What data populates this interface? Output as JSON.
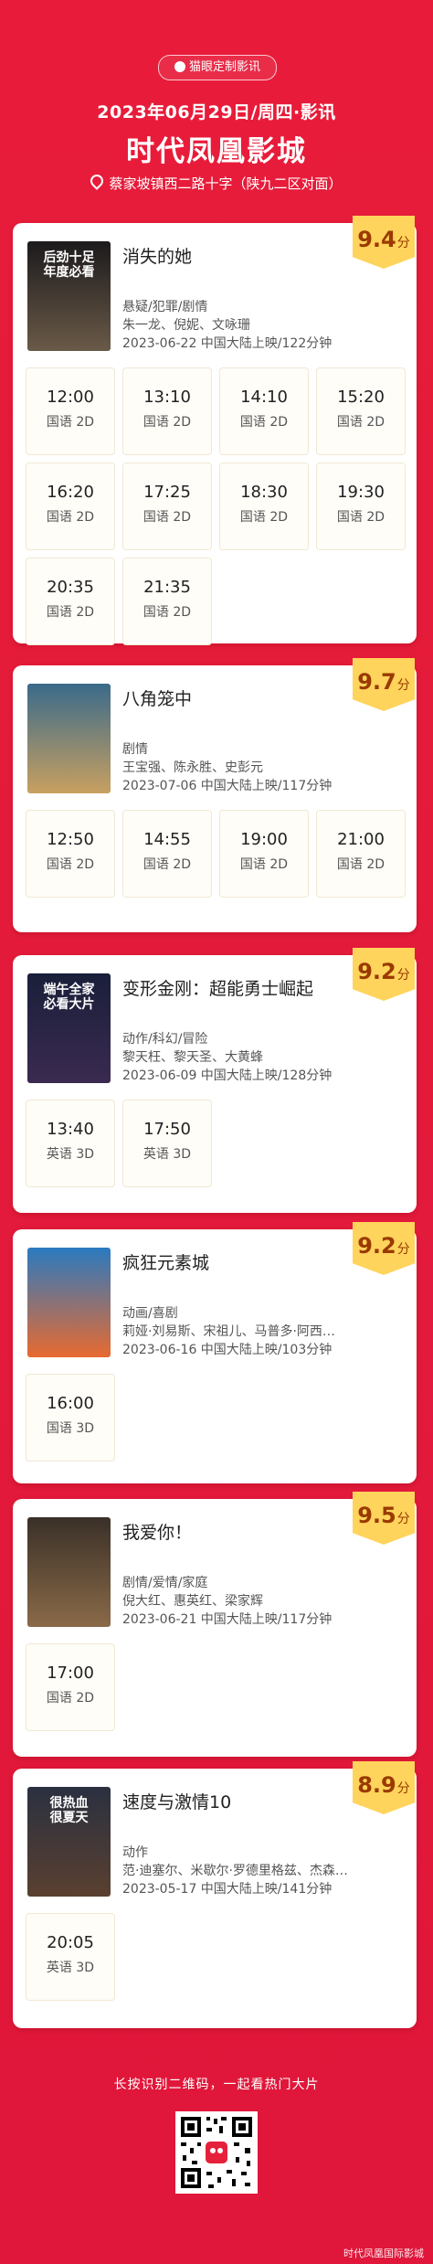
{
  "header": {
    "badge": "猫眼定制影讯",
    "date_line": "2023年06月29日/周四·影讯",
    "cinema_name": "时代凤凰影城",
    "address": "蔡家坡镇西二路十字（陕九二区对面）"
  },
  "movies": [
    {
      "title": "消失的她",
      "score": "9.4",
      "score_unit": "分",
      "genre": "悬疑/犯罪/剧情",
      "cast": "朱一龙、倪妮、文咏珊",
      "release": "2023-06-22 中国大陆上映/122分钟",
      "poster_text": "后劲十足\n年度必看",
      "poster_colors": [
        "#1c1a1c",
        "#6a5a48"
      ],
      "showtimes": [
        {
          "time": "12:00",
          "lang": "国语 2D"
        },
        {
          "time": "13:10",
          "lang": "国语 2D"
        },
        {
          "time": "14:10",
          "lang": "国语 2D"
        },
        {
          "time": "15:20",
          "lang": "国语 2D"
        },
        {
          "time": "16:20",
          "lang": "国语 2D"
        },
        {
          "time": "17:25",
          "lang": "国语 2D"
        },
        {
          "time": "18:30",
          "lang": "国语 2D"
        },
        {
          "time": "19:30",
          "lang": "国语 2D"
        },
        {
          "time": "20:35",
          "lang": "国语 2D"
        },
        {
          "time": "21:35",
          "lang": "国语 2D"
        }
      ]
    },
    {
      "title": "八角笼中",
      "score": "9.7",
      "score_unit": "分",
      "genre": "剧情",
      "cast": "王宝强、陈永胜、史彭元",
      "release": "2023-07-06 中国大陆上映/117分钟",
      "poster_text": "",
      "poster_colors": [
        "#3a6a8a",
        "#c8a060"
      ],
      "showtimes": [
        {
          "time": "12:50",
          "lang": "国语 2D"
        },
        {
          "time": "14:55",
          "lang": "国语 2D"
        },
        {
          "time": "19:00",
          "lang": "国语 2D"
        },
        {
          "time": "21:00",
          "lang": "国语 2D"
        }
      ]
    },
    {
      "title": "变形金刚：超能勇士崛起",
      "score": "9.2",
      "score_unit": "分",
      "genre": "动作/科幻/冒险",
      "cast": "黎天枉、黎天圣、大黄蜂",
      "release": "2023-06-09 中国大陆上映/128分钟",
      "poster_text": "端午全家\n必看大片",
      "poster_colors": [
        "#1a1f3a",
        "#3a2a50"
      ],
      "showtimes": [
        {
          "time": "13:40",
          "lang": "英语 3D"
        },
        {
          "time": "17:50",
          "lang": "英语 3D"
        }
      ]
    },
    {
      "title": "疯狂元素城",
      "score": "9.2",
      "score_unit": "分",
      "genre": "动画/喜剧",
      "cast": "莉娅·刘易斯、宋祖儿、马普多·阿西…",
      "release": "2023-06-16 中国大陆上映/103分钟",
      "poster_text": "",
      "poster_colors": [
        "#2a7ac0",
        "#e86a30"
      ],
      "showtimes": [
        {
          "time": "16:00",
          "lang": "国语 3D"
        }
      ]
    },
    {
      "title": "我爱你！",
      "score": "9.5",
      "score_unit": "分",
      "genre": "剧情/爱情/家庭",
      "cast": "倪大红、惠英红、梁家辉",
      "release": "2023-06-21 中国大陆上映/117分钟",
      "poster_text": "",
      "poster_colors": [
        "#3a3028",
        "#8a6a48"
      ],
      "showtimes": [
        {
          "time": "17:00",
          "lang": "国语 2D"
        }
      ]
    },
    {
      "title": "速度与激情10",
      "score": "8.9",
      "score_unit": "分",
      "genre": "动作",
      "cast": "范·迪塞尔、米歇尔·罗德里格兹、杰森…",
      "release": "2023-05-17 中国大陆上映/141分钟",
      "poster_text": "很热血\n很夏天",
      "poster_colors": [
        "#2a3040",
        "#5a4030"
      ],
      "showtimes": [
        {
          "time": "20:05",
          "lang": "英语 3D"
        }
      ]
    }
  ],
  "footer": {
    "qr_caption": "长按识别二维码，一起看热门大片",
    "credit": "时代凤凰国际影城"
  },
  "colors": {
    "background": "#e6203a",
    "score_badge": "#ffd45c",
    "score_text": "#9a3a00"
  }
}
